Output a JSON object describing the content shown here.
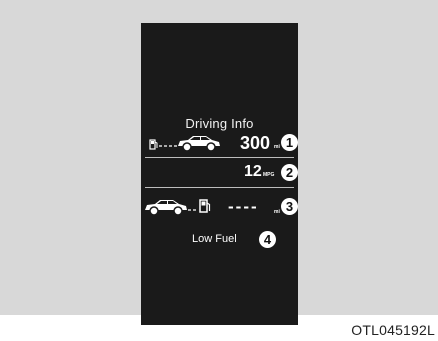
{
  "display": {
    "title": "Driving Info",
    "distance_to_empty": {
      "value": "300",
      "unit": "mi",
      "callout": "1"
    },
    "fuel_economy": {
      "value": "12",
      "unit": "MPG",
      "callout": "2"
    },
    "range_since_refuel": {
      "value": "----",
      "unit": "mi",
      "callout": "3"
    },
    "warning": {
      "text": "Low Fuel",
      "callout": "4"
    }
  },
  "figure_code": "OTL045192L",
  "colors": {
    "screen": "#1a1a1a",
    "panel": "#d8d8d8",
    "text": "#ffffff"
  },
  "icons": [
    "fuel-pump-icon",
    "car-icon"
  ]
}
